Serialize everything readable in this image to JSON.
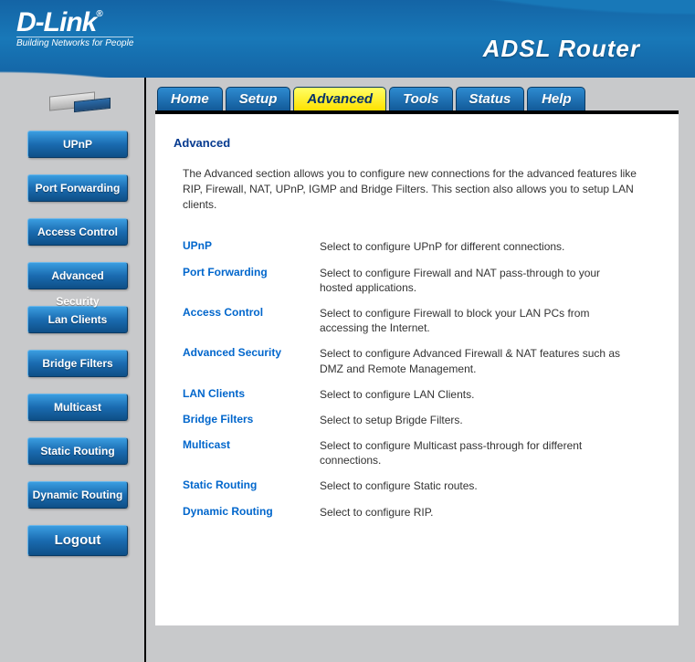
{
  "brand": {
    "name": "D-Link",
    "tagline": "Building Networks for People"
  },
  "product_title": "ADSL Router",
  "tabs": [
    {
      "id": "home",
      "label": "Home",
      "active": false
    },
    {
      "id": "setup",
      "label": "Setup",
      "active": false
    },
    {
      "id": "advanced",
      "label": "Advanced",
      "active": true
    },
    {
      "id": "tools",
      "label": "Tools",
      "active": false
    },
    {
      "id": "status",
      "label": "Status",
      "active": false
    },
    {
      "id": "help",
      "label": "Help",
      "active": false
    }
  ],
  "sidebar": [
    {
      "id": "upnp",
      "label": "UPnP"
    },
    {
      "id": "port-forwarding",
      "label": "Port Forwarding"
    },
    {
      "id": "access-control",
      "label": "Access Control"
    },
    {
      "id": "advanced-security",
      "label": "Advanced Security"
    },
    {
      "id": "lan-clients",
      "label": "Lan Clients"
    },
    {
      "id": "bridge-filters",
      "label": "Bridge Filters"
    },
    {
      "id": "multicast",
      "label": "Multicast"
    },
    {
      "id": "static-routing",
      "label": "Static Routing"
    },
    {
      "id": "dynamic-routing",
      "label": "Dynamic Routing"
    }
  ],
  "logout_label": "Logout",
  "page": {
    "heading": "Advanced",
    "intro": "The Advanced section allows you to configure new connections for the advanced features like RIP, Firewall, NAT, UPnP, IGMP and Bridge Filters. This section also allows you to setup LAN clients.",
    "features": [
      {
        "name": "UPnP",
        "desc": "Select to configure UPnP for different connections."
      },
      {
        "name": "Port Forwarding",
        "desc": "Select to configure Firewall and NAT pass-through to your hosted applications."
      },
      {
        "name": "Access Control",
        "desc": "Select to configure Firewall to block your LAN PCs from accessing the Internet."
      },
      {
        "name": "Advanced Security",
        "desc": "Select to configure Advanced Firewall & NAT features such as DMZ and Remote Management."
      },
      {
        "name": "LAN Clients",
        "desc": "Select to configure LAN Clients."
      },
      {
        "name": "Bridge Filters",
        "desc": "Select to setup Brigde Filters."
      },
      {
        "name": "Multicast",
        "desc": "Select to configure Multicast pass-through for different connections."
      },
      {
        "name": "Static Routing",
        "desc": "Select to configure Static routes."
      },
      {
        "name": "Dynamic Routing",
        "desc": "Select to configure RIP."
      }
    ]
  }
}
